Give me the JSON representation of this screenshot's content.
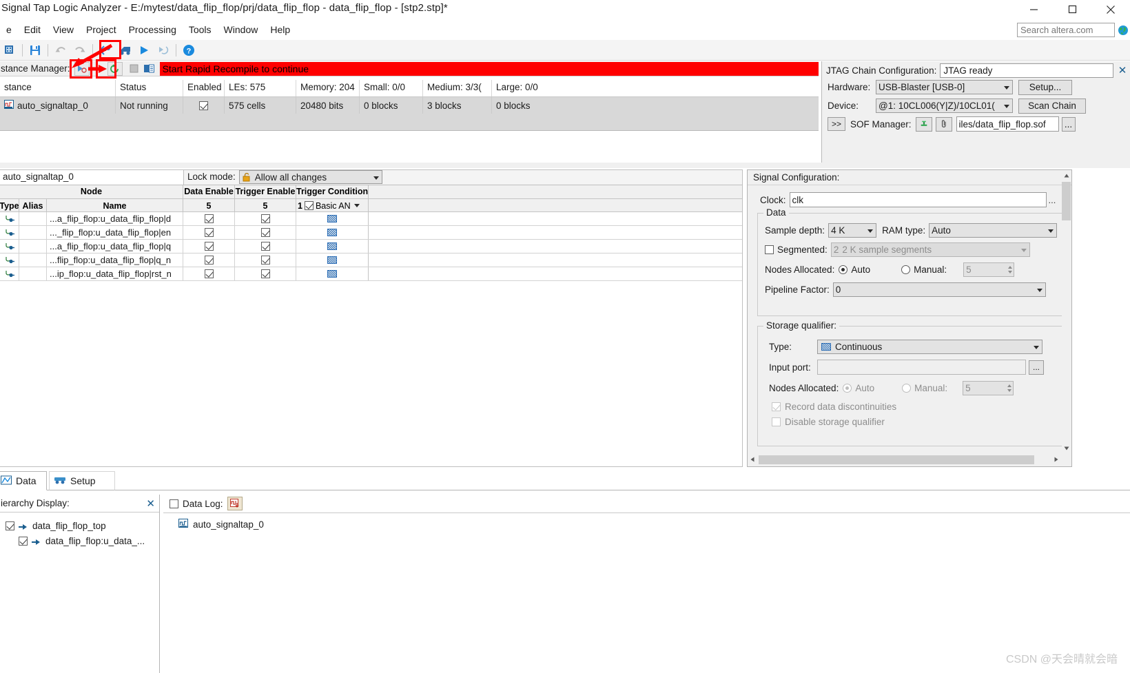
{
  "window": {
    "title": "Signal Tap Logic Analyzer - E:/mytest/data_flip_flop/prj/data_flip_flop - data_flip_flop - [stp2.stp]*",
    "minimize": "—",
    "maximize": "□",
    "close": "✕"
  },
  "menu": {
    "items": [
      "e",
      "Edit",
      "View",
      "Project",
      "Processing",
      "Tools",
      "Window",
      "Help"
    ]
  },
  "search": {
    "placeholder": "Search altera.com"
  },
  "toolbar": {
    "icons": [
      "new-project-icon",
      "save-icon",
      "undo-icon",
      "redo-icon",
      "compile-icon",
      "programmer-icon",
      "run-analysis-icon",
      "autorun-icon",
      "help-icon"
    ]
  },
  "instance_manager": {
    "label": "stance Manager:",
    "status_message": "Start Rapid Recompile to continue",
    "buttons": [
      "run-analysis-icon",
      "rapid-recompile-icon",
      "stop-icon",
      "program-device-icon"
    ],
    "close": "✕",
    "columns": [
      "stance",
      "Status",
      "Enabled",
      "LEs: 575",
      "Memory: 204",
      "Small: 0/0",
      "Medium: 3/3(",
      "Large: 0/0"
    ],
    "rows": [
      {
        "instance": "auto_signaltap_0",
        "status": "Not running",
        "enabled": true,
        "les": "575 cells",
        "memory": "20480 bits",
        "small": "0 blocks",
        "medium": "3 blocks",
        "large": "0 blocks"
      }
    ]
  },
  "jtag": {
    "title": "JTAG Chain Configuration:",
    "status": "JTAG ready",
    "close": "✕",
    "hardware_label": "Hardware:",
    "hardware_value": "USB-Blaster [USB-0]",
    "setup_button": "Setup...",
    "device_label": "Device:",
    "device_value": "@1: 10CL006(Y|Z)/10CL01(",
    "scan_button": "Scan Chain",
    "expand_button": ">>",
    "sof_label": "SOF Manager:",
    "sof_path": "iles/data_flip_flop.sof",
    "sof_more": "..."
  },
  "node_editor": {
    "instance_name": "auto_signaltap_0",
    "lock_mode_label": "Lock mode:",
    "lock_mode_value": "Allow all changes",
    "group_header_node": "Node",
    "headers": [
      "Type",
      "Alias",
      "Name",
      "Data Enable",
      "Trigger Enable",
      "Trigger Conditions"
    ],
    "counts": {
      "data_enable": "5",
      "trigger_enable": "5",
      "trigger_condition_index": "1",
      "trigger_condition_value": "Basic AN"
    },
    "rows": [
      {
        "name": "...a_flip_flop:u_data_flip_flop|d",
        "data_enable": true,
        "trigger_enable": true,
        "condition": "hatch"
      },
      {
        "name": "..._flip_flop:u_data_flip_flop|en",
        "data_enable": true,
        "trigger_enable": true,
        "condition": "hatch"
      },
      {
        "name": "...a_flip_flop:u_data_flip_flop|q",
        "data_enable": true,
        "trigger_enable": true,
        "condition": "hatch"
      },
      {
        "name": "...flip_flop:u_data_flip_flop|q_n",
        "data_enable": true,
        "trigger_enable": true,
        "condition": "hatch"
      },
      {
        "name": "...ip_flop:u_data_flip_flop|rst_n",
        "data_enable": true,
        "trigger_enable": true,
        "condition": "hatch"
      }
    ]
  },
  "signal_config": {
    "title": "Signal Configuration:",
    "close": "✕",
    "clock_label": "Clock:",
    "clock_value": "clk",
    "clock_browse": "...",
    "data_group": "Data",
    "sample_depth_label": "Sample depth:",
    "sample_depth_value": "4 K",
    "ram_type_label": "RAM type:",
    "ram_type_value": "Auto",
    "segmented_label": "Segmented:",
    "segmented_checked": false,
    "segmented_count": "2",
    "segmented_value": "2 K sample segments",
    "nodes_allocated_label": "Nodes Allocated:",
    "auto_label": "Auto",
    "manual_label": "Manual:",
    "manual_value": "5",
    "pipeline_label": "Pipeline Factor:",
    "pipeline_value": "0",
    "storage_group": "Storage qualifier:",
    "type_label": "Type:",
    "type_value": "Continuous",
    "input_port_label": "Input port:",
    "input_port_value": "",
    "input_port_browse": "...",
    "sq_nodes_label": "Nodes Allocated:",
    "sq_auto_label": "Auto",
    "sq_manual_label": "Manual:",
    "sq_manual_value": "5",
    "record_label": "Record data discontinuities",
    "record_checked": true,
    "disable_label": "Disable storage qualifier",
    "disable_checked": false
  },
  "tabs": [
    {
      "label": "Data",
      "icon": "data-tab-icon",
      "active": true
    },
    {
      "label": "Setup",
      "icon": "setup-tab-icon",
      "active": false
    }
  ],
  "hierarchy": {
    "title": "ierarchy Display:",
    "close": "✕",
    "nodes": [
      {
        "label": "data_flip_flop_top",
        "checked": true,
        "depth": 0
      },
      {
        "label": "data_flip_flop:u_data_...",
        "checked": true,
        "depth": 1
      }
    ]
  },
  "data_log": {
    "label": "Data Log:",
    "checked": false,
    "icon": "data-log-icon",
    "entries": [
      {
        "label": "auto_signaltap_0",
        "icon": "signaltap-instance-icon"
      }
    ]
  },
  "watermark": "CSDN @天会晴就会暗",
  "colors": {
    "status_banner": "#ff0000",
    "annotation": "#ff0000",
    "accent_blue": "#1b5e8f",
    "panel_bg": "#f0f0f0"
  }
}
